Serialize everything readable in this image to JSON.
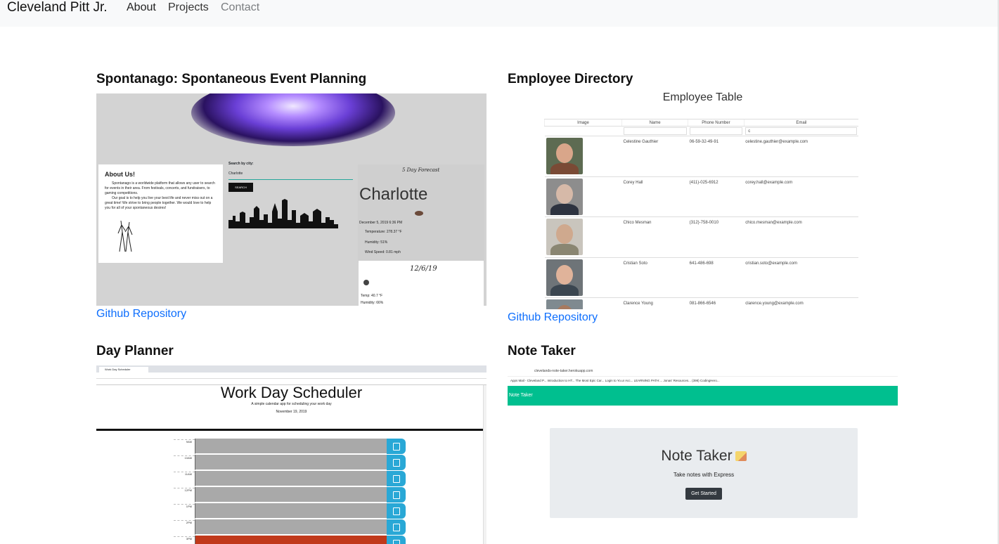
{
  "navbar": {
    "brand": "Cleveland Pitt Jr.",
    "links": [
      "About",
      "Projects",
      "Contact"
    ]
  },
  "projects": [
    {
      "title": "Spontanago: Spontaneous Event Planning",
      "link": "Github Repository",
      "preview": {
        "about_heading": "About Us!",
        "about_text_1": "Spontanago is a worldwide platform that allows any user to search for events in their area. From festivals, concerts, and fundraisers, to gaming competitions.",
        "about_text_2": "Our goal is to help you live your best life and never miss out on a great time! We strive to bring people together. We would love to help you for all of your spontaneous desires!",
        "search_label": "Search by city:",
        "search_value": "Charlotte",
        "search_button": "SEARCH",
        "forecast_title": "5 Day Forecast",
        "city": "Charlotte",
        "date_time": "December 5, 2019 6:36 PM",
        "temperature": "Temperature: 278.37 °F",
        "humidity": "Humidity: 51%",
        "wind": "Wind Speed: 0.81 mph",
        "card_date": "12/6/19",
        "card_temp": "Temp: 40.7 °F",
        "card_humidity": "Humidity: 66%"
      }
    },
    {
      "title": "Employee Directory",
      "link": "Github Repository",
      "preview": {
        "table_title": "Employee Table",
        "columns": [
          "Image",
          "Name",
          "Phone Number",
          "Email"
        ],
        "filter_value": "c",
        "rows": [
          {
            "name": "Celestine Gauthier",
            "phone": "06-59-32-49-91",
            "email": "celestine.gauthier@example.com"
          },
          {
            "name": "Corey Hall",
            "phone": "(411)-025-6912",
            "email": "corey.hall@example.com"
          },
          {
            "name": "Chico Mesman",
            "phone": "(312)-758-0010",
            "email": "chico.mesman@example.com"
          },
          {
            "name": "Cristian Soto",
            "phone": "641-486-698",
            "email": "cristian.soto@example.com"
          },
          {
            "name": "Clarence Young",
            "phone": "081-866-6546",
            "email": "clarence.young@example.com"
          }
        ]
      }
    },
    {
      "title": "Day Planner",
      "preview": {
        "tab_label": "Work Day Scheduler",
        "title": "Work Day Scheduler",
        "subtitle": "A simple calendar app for scheduling your work day",
        "date": "November 19, 2019",
        "hours": [
          "9AM",
          "10AM",
          "11AM",
          "12PM",
          "1PM",
          "2PM",
          "3PM"
        ]
      }
    },
    {
      "title": "Note Taker",
      "preview": {
        "url": "clevelands-note-taker.herokuapp.com",
        "bookmarks": "Apps   Mail - Cleveland P...   Introduction to HT...   The Most Epic Car...   Login to Yo.ur Acc...   LEARNING PATH:...   Jonas' Resources...   (398) CodingHero...",
        "navbar_label": "Note Taker",
        "heading": "Note Taker",
        "subheading": "Take notes with Express",
        "button": "Get Started"
      }
    }
  ]
}
